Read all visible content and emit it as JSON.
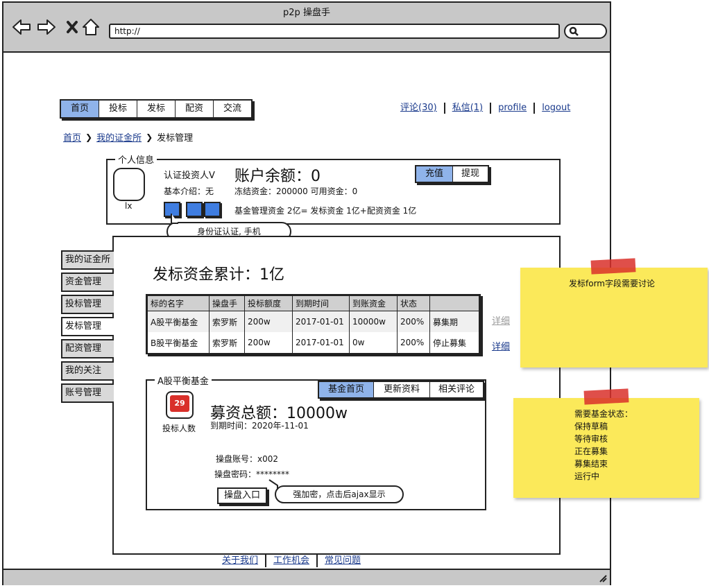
{
  "window": {
    "title": "p2p 操盘手",
    "url": "http://"
  },
  "topnav": {
    "tabs": [
      {
        "label": "首页",
        "active": true
      },
      {
        "label": "投标",
        "active": false
      },
      {
        "label": "发标",
        "active": false
      },
      {
        "label": "配资",
        "active": false
      },
      {
        "label": "交流",
        "active": false
      }
    ]
  },
  "toplinks": [
    "评论(30)",
    "私信(1)",
    "profile",
    "logout"
  ],
  "breadcrumb": {
    "items": [
      "首页",
      "我的证金所",
      "发标管理"
    ]
  },
  "profile": {
    "legend": "个人信息",
    "username": "lx",
    "title": "认证投资人V",
    "intro": "基本介绍：无",
    "balance_label": "账户余额：0",
    "frozen": "冻结资金：200000 可用资金：0",
    "fund_summary": "基金管理资金 2亿= 发标资金 1亿+配资资金 1亿",
    "callout": "身份证认证, 手机",
    "buttons": [
      "充值",
      "提现"
    ]
  },
  "sidenav": {
    "items": [
      {
        "label": "我的证金所",
        "active": false
      },
      {
        "label": "资金管理",
        "active": false
      },
      {
        "label": "投标管理",
        "active": false
      },
      {
        "label": "发标管理",
        "active": true
      },
      {
        "label": "配资管理",
        "active": false
      },
      {
        "label": "我的关注",
        "active": false
      },
      {
        "label": "账号管理",
        "active": false
      }
    ]
  },
  "main": {
    "heading": "发标资金累计：1亿",
    "table": {
      "headers": [
        "标的名字",
        "操盘手",
        "投标额度",
        "到期时间",
        "到账资金",
        "状态",
        ""
      ],
      "rows": [
        [
          "A股平衡基金",
          "索罗斯",
          "200w",
          "2017-01-01",
          "10000w",
          "200%",
          "募集期"
        ],
        [
          "B股平衡基金",
          "索罗斯",
          "200w",
          "2017-01-01",
          "0w",
          "200%",
          "停止募集"
        ]
      ],
      "detail_links": [
        "详细",
        "详细"
      ]
    },
    "fund": {
      "legend": "A股平衡基金",
      "tabs": [
        {
          "label": "基金首页",
          "active": true
        },
        {
          "label": "更新资料",
          "active": false
        },
        {
          "label": "相关评论",
          "active": false
        }
      ],
      "badge_count": "29",
      "badge_label": "投标人数",
      "raised": "募资总额：10000w",
      "expiry": "到期时间：2020年-11-01",
      "account": "操盘账号：x002",
      "password": "操盘密码：********",
      "entry_button": "操盘入口",
      "callout": "强加密，点击后ajax显示"
    }
  },
  "notes": {
    "note1": "发标form字段需要讨论",
    "note2": [
      "需要基金状态：",
      "保持草稿",
      "等待审核",
      "正在募集",
      "募集结束",
      "运行中"
    ]
  },
  "footer": [
    "关于我们",
    "工作机会",
    "常见问题"
  ],
  "colors": {
    "accent_blue": "#8fb3ea",
    "icon_blue": "#3f7de0",
    "badge_red": "#d9302a",
    "note_yellow": "#fbe95a"
  }
}
